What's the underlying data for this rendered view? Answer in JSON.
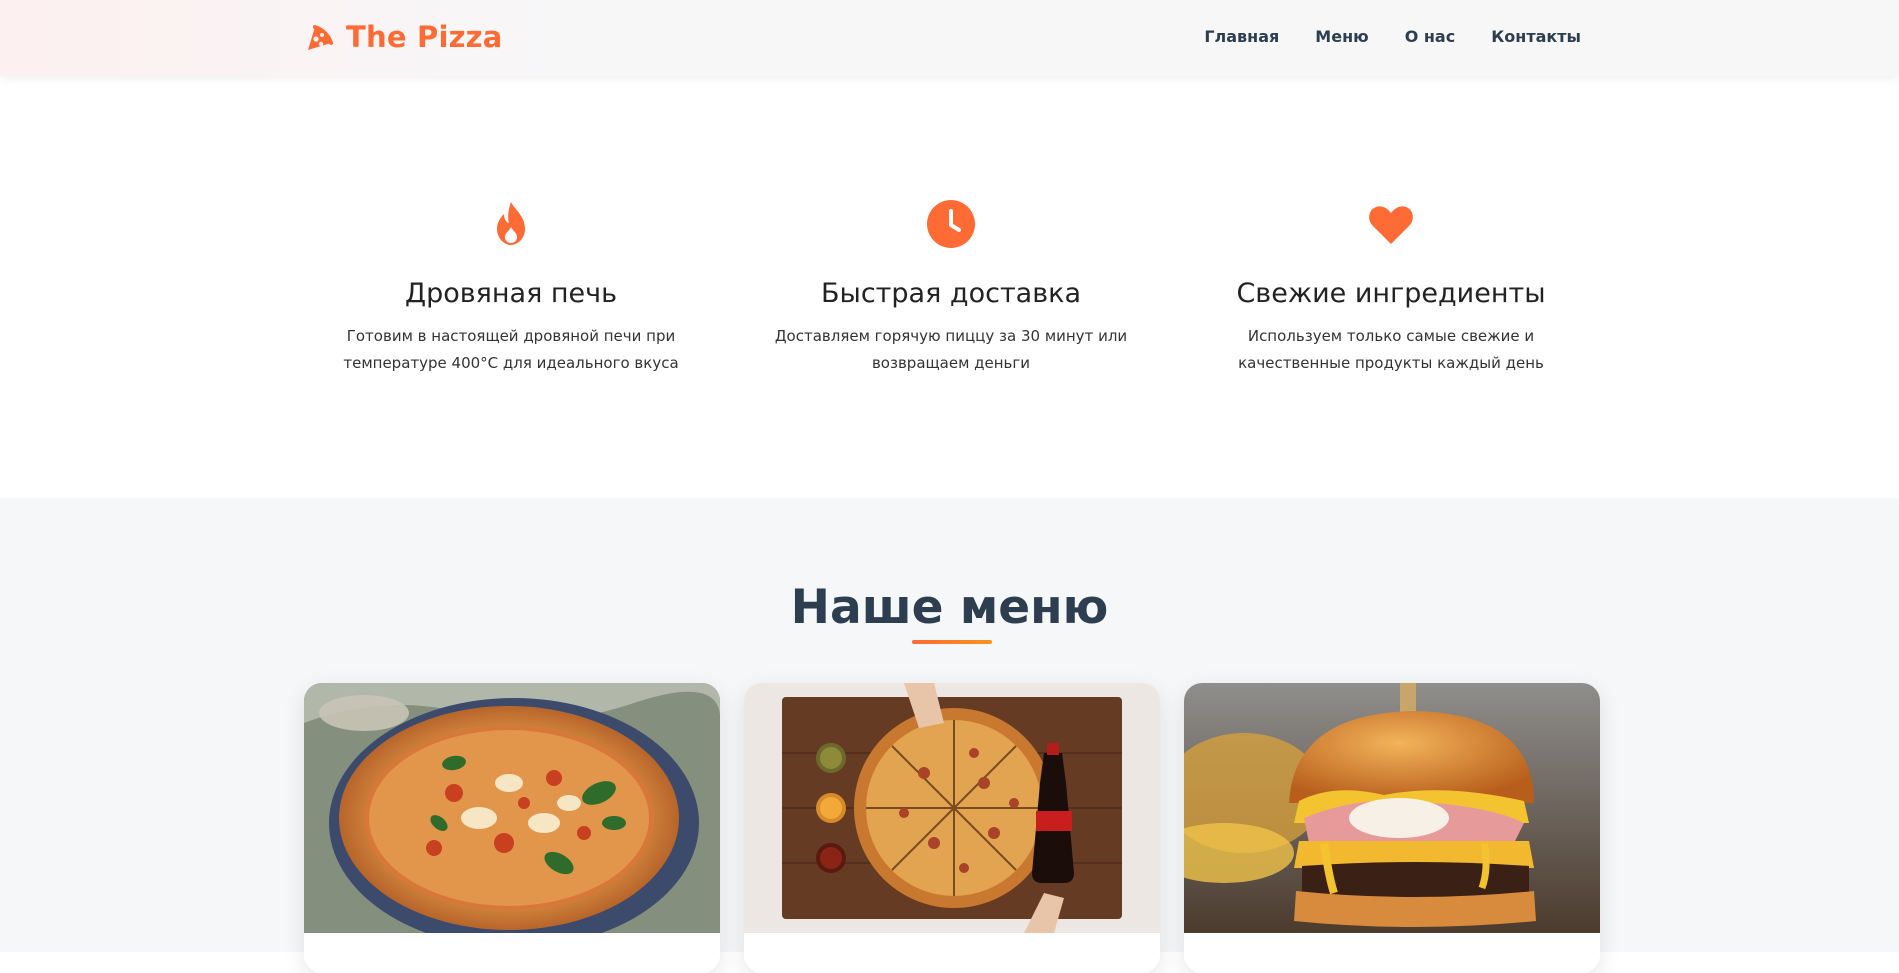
{
  "header": {
    "logo_text": "The Pizza",
    "nav": [
      {
        "label": "Главная"
      },
      {
        "label": "Меню"
      },
      {
        "label": "О нас"
      },
      {
        "label": "Контакты"
      }
    ]
  },
  "features": [
    {
      "icon": "fire-icon",
      "title": "Дровяная печь",
      "text": "Готовим в настоящей дровяной печи при температуре 400°C для идеального вкуса"
    },
    {
      "icon": "clock-icon",
      "title": "Быстрая доставка",
      "text": "Доставляем горячую пиццу за 30 минут или возвращаем деньги"
    },
    {
      "icon": "heart-icon",
      "title": "Свежие ингредиенты",
      "text": "Используем только самые свежие и качественные продукты каждый день"
    }
  ],
  "menu": {
    "title": "Наше меню",
    "items": [
      {
        "image": "margherita-pizza-image"
      },
      {
        "image": "pepperoni-pizza-board-image"
      },
      {
        "image": "burger-image"
      }
    ]
  },
  "colors": {
    "accent": "#ff6b35",
    "accent_secondary": "#f7931e",
    "heading": "#2c3e50",
    "section_bg": "#f6f7f9"
  }
}
